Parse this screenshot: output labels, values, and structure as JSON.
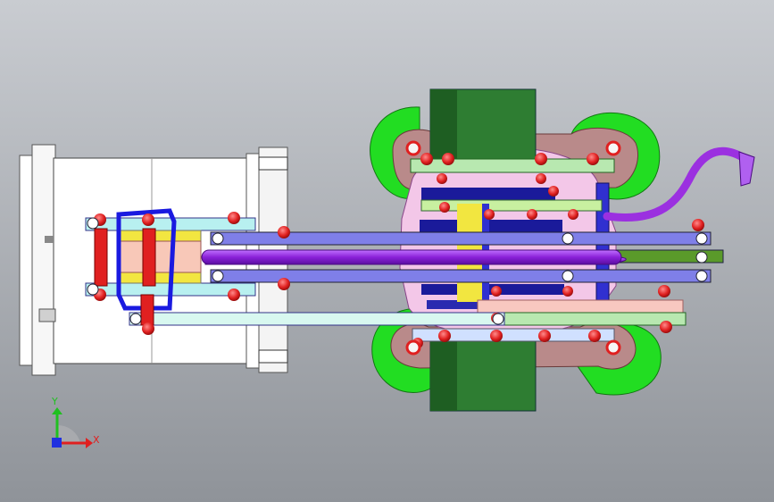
{
  "triad": {
    "x_label": "X",
    "y_label": "Y",
    "x_color": "#e02020",
    "y_color": "#20c020",
    "z_color": "#2030e0"
  },
  "colors": {
    "background_top": "#c9ccd1",
    "background_bottom": "#8f9399",
    "frame": "#ffffff",
    "cylinder_green": "#2e7d32",
    "lobe_green": "#22dd22",
    "plate_pink": "#f3c7e8",
    "hose_purple": "#9b30e0",
    "bolt_red": "#e02020",
    "link_blue": "#7f7fe8",
    "link_cyan": "#b8f0f0",
    "link_lightgreen": "#b8e8b0",
    "yellow": "#f2e640",
    "navy": "#1a1a9a"
  }
}
